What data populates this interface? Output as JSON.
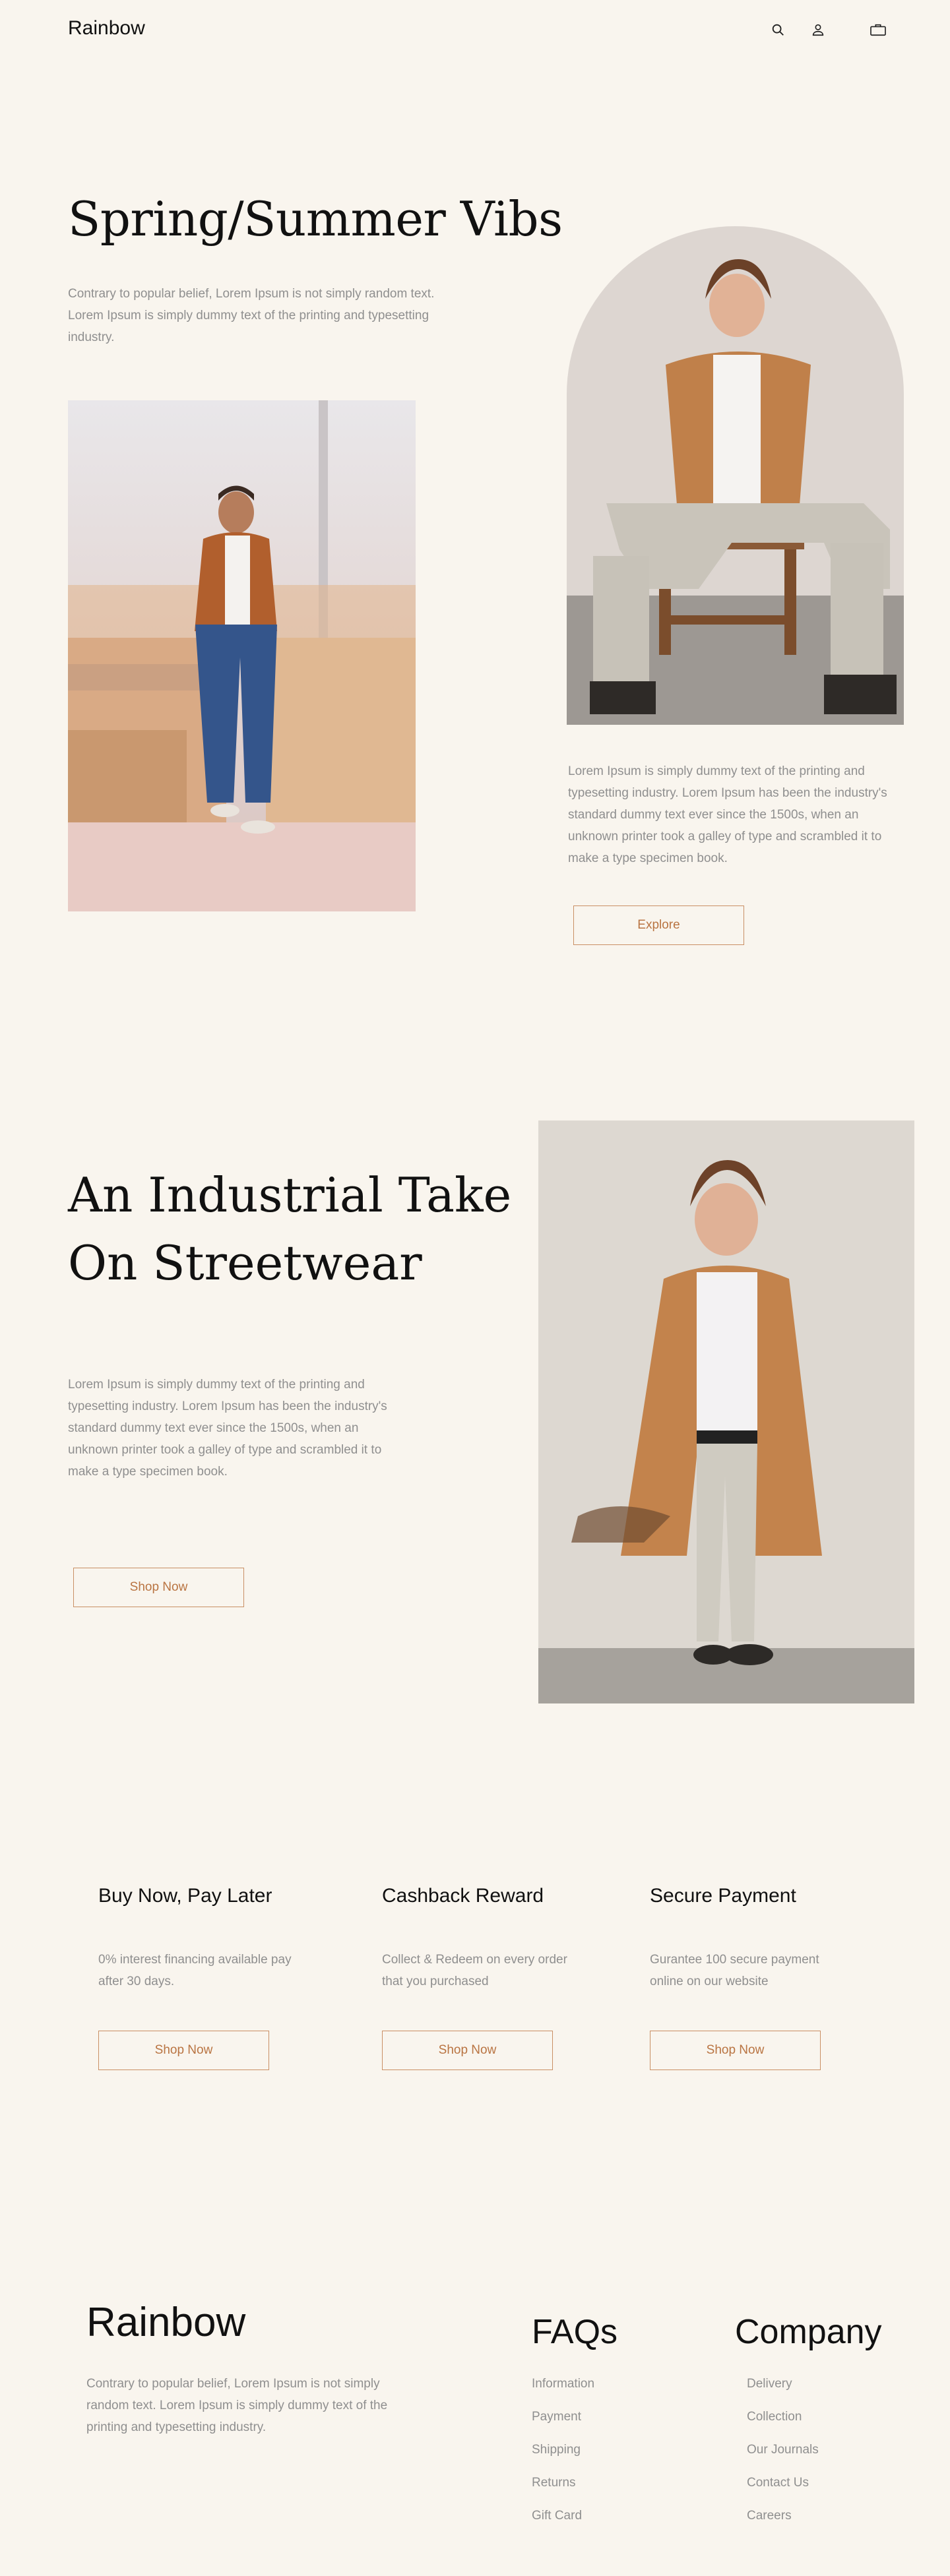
{
  "header": {
    "logo": "Rainbow",
    "icons": [
      "search-icon",
      "user-icon",
      "bag-icon"
    ]
  },
  "hero": {
    "title": "Spring/Summer Vibs",
    "intro": "Contrary to popular belief, Lorem Ipsum is not simply random text.  Lorem Ipsum is simply dummy text of the printing and typesetting industry.",
    "body": "Lorem Ipsum is simply dummy text of the printing and typesetting industry. Lorem Ipsum has been the industry's standard dummy text ever since the 1500s, when an unknown printer took a galley of type and scrambled it to make a type specimen book.",
    "cta": "Explore"
  },
  "streetwear": {
    "title_line1": "An Industrial Take",
    "title_line2": "On Streetwear",
    "body": "Lorem Ipsum is simply dummy text of the printing and typesetting industry. Lorem Ipsum has been the industry's standard dummy text ever since the 1500s, when an unknown printer took a galley of type and scrambled it to make a type specimen book.",
    "cta": "Shop Now"
  },
  "features": [
    {
      "title": "Buy Now, Pay Later",
      "text": "0% interest financing available pay after 30 days.",
      "cta": "Shop Now"
    },
    {
      "title": "Cashback Reward",
      "text": "Collect & Redeem on every order that you purchased",
      "cta": "Shop Now"
    },
    {
      "title": "Secure Payment",
      "text": "Gurantee 100 secure payment online on our website",
      "cta": "Shop Now"
    }
  ],
  "footer": {
    "logo": "Rainbow",
    "about": "Contrary to popular belief, Lorem Ipsum is not simply random text.  Lorem Ipsum is simply dummy text of the printing and typesetting industry.",
    "faqs_title": "FAQs",
    "faqs": [
      "Information",
      "Payment",
      "Shipping",
      "Returns",
      "Gift Card"
    ],
    "company_title": "Company",
    "company": [
      "Delivery",
      "Collection",
      "Our Journals",
      "Contact Us",
      "Careers"
    ]
  },
  "colors": {
    "background": "#f9f5ee",
    "accent": "#c98f64",
    "text_muted": "#8f8f8f"
  }
}
